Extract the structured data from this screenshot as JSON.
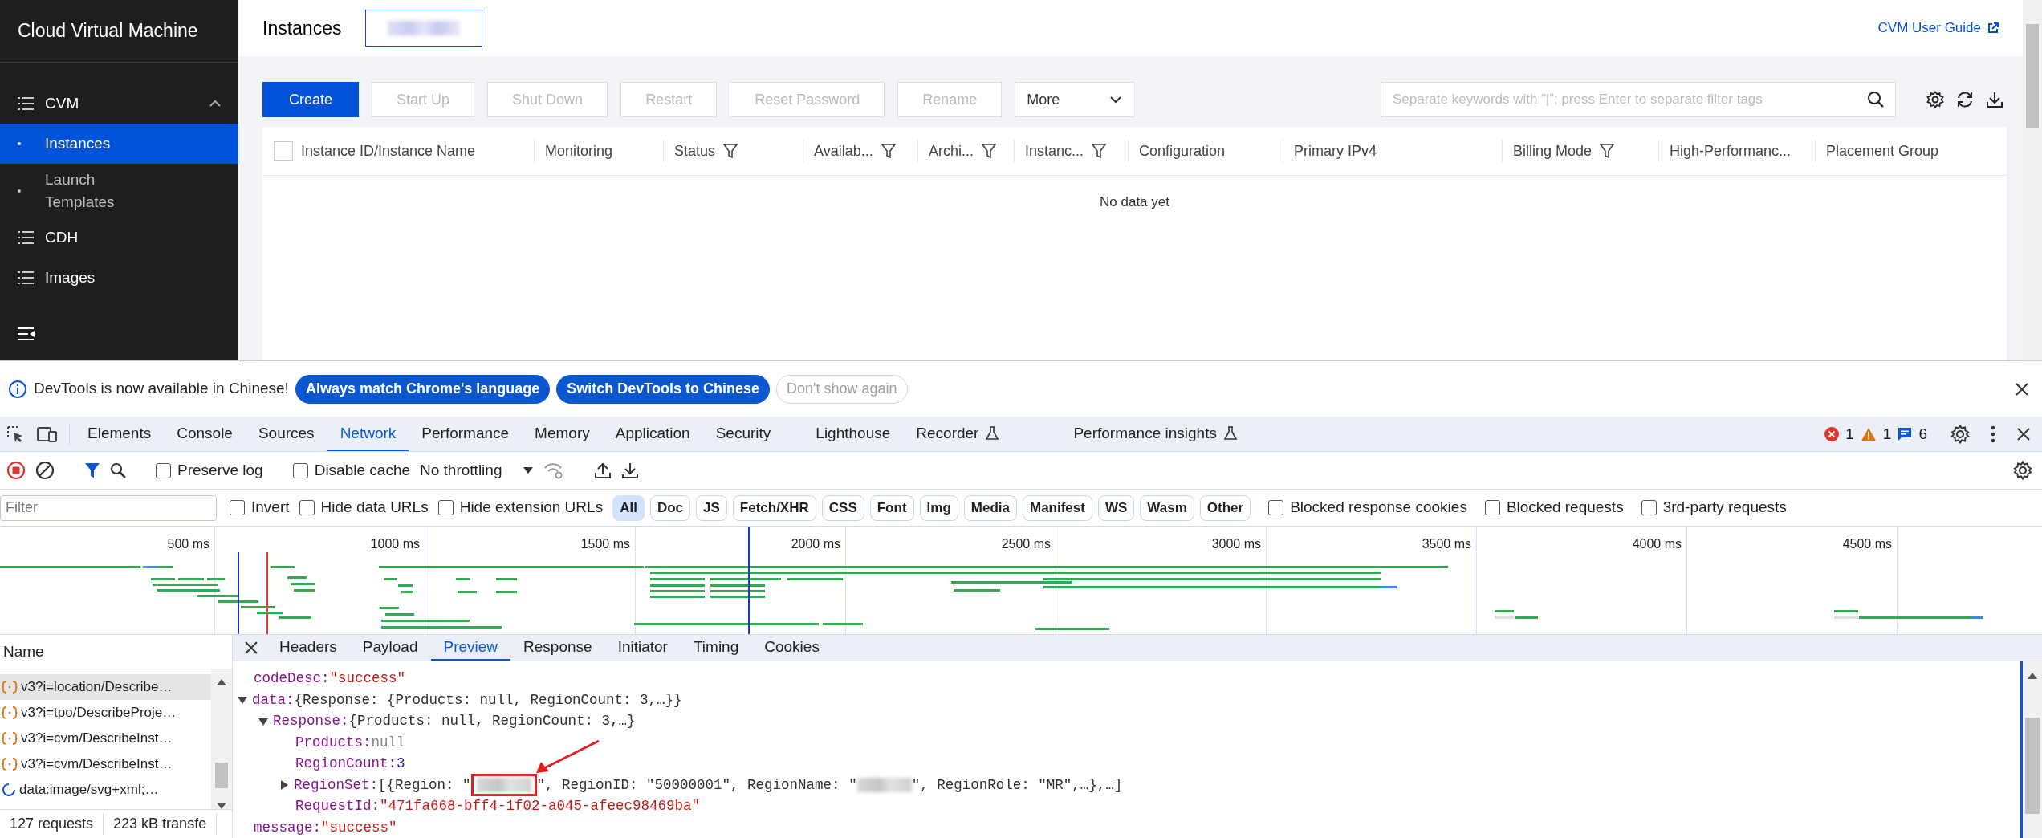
{
  "sidebar": {
    "title": "Cloud Virtual Machine",
    "items": [
      {
        "label": "CVM",
        "children": [
          {
            "label": "Instances",
            "selected": true
          },
          {
            "label": "Launch Templates",
            "selected": false
          }
        ]
      },
      {
        "label": "CDH"
      },
      {
        "label": "Images"
      }
    ]
  },
  "header": {
    "title": "Instances",
    "region_tab": {
      "kind": "redacted"
    },
    "guide_link": "CVM User Guide"
  },
  "toolbar": {
    "buttons": [
      {
        "label": "Create",
        "kind": "primary",
        "disabled": false
      },
      {
        "label": "Start Up",
        "kind": "default",
        "disabled": true
      },
      {
        "label": "Shut Down",
        "kind": "default",
        "disabled": true
      },
      {
        "label": "Restart",
        "kind": "default",
        "disabled": true
      },
      {
        "label": "Reset Password",
        "kind": "default",
        "disabled": true
      },
      {
        "label": "Rename",
        "kind": "default",
        "disabled": true
      }
    ],
    "more": "More",
    "search": {
      "placeholder": "Separate keywords with ”|”; press Enter to separate filter tags"
    }
  },
  "table": {
    "columns": [
      {
        "label": "Instance ID/Instance Name",
        "filter": false
      },
      {
        "label": "Monitoring",
        "filter": false
      },
      {
        "label": "Status",
        "filter": true
      },
      {
        "label": "Availab...",
        "filter": true
      },
      {
        "label": "Archi...",
        "filter": true
      },
      {
        "label": "Instanc...",
        "filter": true
      },
      {
        "label": "Configuration",
        "filter": false
      },
      {
        "label": "Primary IPv4",
        "filter": false
      },
      {
        "label": "Billing Mode",
        "filter": true
      },
      {
        "label": "High-Performanc...",
        "filter": false
      },
      {
        "label": "Placement Group",
        "filter": false
      }
    ],
    "select_all": {
      "checked": false
    },
    "empty_text": "No data yet"
  },
  "devtools": {
    "infobar": {
      "message": "DevTools is now available in Chinese!",
      "buttons": [
        {
          "label": "Always match Chrome's language",
          "kind": "primary"
        },
        {
          "label": "Switch DevTools to Chinese",
          "kind": "primary"
        },
        {
          "label": "Don't show again",
          "kind": "outline"
        }
      ]
    },
    "tabs": [
      {
        "label": "Elements",
        "selected": false,
        "experimental": false
      },
      {
        "label": "Console",
        "selected": false,
        "experimental": false
      },
      {
        "label": "Sources",
        "selected": false,
        "experimental": false
      },
      {
        "label": "Network",
        "selected": true,
        "experimental": false
      },
      {
        "label": "Performance",
        "selected": false,
        "experimental": false
      },
      {
        "label": "Memory",
        "selected": false,
        "experimental": false
      },
      {
        "label": "Application",
        "selected": false,
        "experimental": false
      },
      {
        "label": "Security",
        "selected": false,
        "experimental": false
      },
      {
        "label": "Lighthouse",
        "selected": false,
        "experimental": false
      },
      {
        "label": "Recorder",
        "selected": false,
        "experimental": true
      },
      {
        "label": "Performance insights",
        "selected": false,
        "experimental": true
      }
    ],
    "counts": {
      "errors": "1",
      "warnings": "1",
      "messages": "6"
    },
    "network_toolbar": {
      "checkboxes": [
        {
          "label": "Preserve log",
          "checked": false
        },
        {
          "label": "Disable cache",
          "checked": false
        }
      ],
      "throttling": "No throttling"
    },
    "filter": {
      "placeholder": "Filter",
      "checkboxes": [
        {
          "label": "Invert",
          "checked": false
        },
        {
          "label": "Hide data URLs",
          "checked": false
        },
        {
          "label": "Hide extension URLs",
          "checked": false
        }
      ],
      "types": [
        {
          "label": "All",
          "selected": true
        },
        {
          "label": "Doc",
          "selected": false
        },
        {
          "label": "JS",
          "selected": false
        },
        {
          "label": "Fetch/XHR",
          "selected": false
        },
        {
          "label": "CSS",
          "selected": false
        },
        {
          "label": "Font",
          "selected": false
        },
        {
          "label": "Img",
          "selected": false
        },
        {
          "label": "Media",
          "selected": false
        },
        {
          "label": "Manifest",
          "selected": false
        },
        {
          "label": "WS",
          "selected": false
        },
        {
          "label": "Wasm",
          "selected": false
        },
        {
          "label": "Other",
          "selected": false
        }
      ],
      "more_checkboxes": [
        {
          "label": "Blocked response cookies",
          "checked": false
        },
        {
          "label": "Blocked requests",
          "checked": false
        },
        {
          "label": "3rd-party requests",
          "checked": false
        }
      ]
    },
    "timeline": {
      "ticks": [
        "500 ms",
        "1000 ms",
        "1500 ms",
        "2000 ms",
        "2500 ms",
        "3000 ms",
        "3500 ms",
        "4000 ms",
        "4500 ms"
      ]
    },
    "requests_header": "Name",
    "requests": [
      {
        "name": "v3?i=location/Describe…",
        "kind": "fetch",
        "selected": true
      },
      {
        "name": "v3?i=tpo/DescribeProje…",
        "kind": "fetch",
        "selected": false
      },
      {
        "name": "v3?i=cvm/DescribeInst…",
        "kind": "fetch",
        "selected": false
      },
      {
        "name": "v3?i=cvm/DescribeInst…",
        "kind": "fetch",
        "selected": false
      },
      {
        "name": "data:image/svg+xml;…",
        "kind": "loading",
        "selected": false
      }
    ],
    "summary": [
      "127 requests",
      "223 kB transfe"
    ],
    "detail_tabs": [
      {
        "label": "Headers",
        "selected": false
      },
      {
        "label": "Payload",
        "selected": false
      },
      {
        "label": "Preview",
        "selected": true
      },
      {
        "label": "Response",
        "selected": false
      },
      {
        "label": "Initiator",
        "selected": false
      },
      {
        "label": "Timing",
        "selected": false
      },
      {
        "label": "Cookies",
        "selected": false
      }
    ],
    "preview": [
      {
        "key": "codeDesc:",
        "value": "\"success\"",
        "kind": "string"
      },
      {
        "key": "data:",
        "value": "{Response: {Products: null, RegionCount: 3,…}}",
        "kind": "object",
        "expanded": true,
        "children": [
          {
            "key": "Response:",
            "value": "{Products: null, RegionCount: 3,…}",
            "kind": "object",
            "expanded": true,
            "children": [
              {
                "key": "Products:",
                "value": "null",
                "kind": "null"
              },
              {
                "key": "RegionCount:",
                "value": "3",
                "kind": "number"
              },
              {
                "key": "RegionSet:",
                "kind": "object",
                "expanded": false,
                "parts": [
                  {
                    "text": "[{Region: \""
                  },
                  {
                    "kind": "redacted",
                    "highlighted": true
                  },
                  {
                    "text": "\", RegionID: \"50000001\", RegionName: \""
                  },
                  {
                    "kind": "redacted",
                    "highlighted": false
                  },
                  {
                    "text": "\", RegionRole: \"MR\",…},…]"
                  }
                ]
              },
              {
                "key": "RequestId:",
                "value": "\"471fa668-bff4-1f02-a045-afeec98469ba\"",
                "kind": "string"
              }
            ]
          }
        ]
      },
      {
        "key": "message:",
        "value": "\"success\"",
        "kind": "string"
      }
    ]
  }
}
